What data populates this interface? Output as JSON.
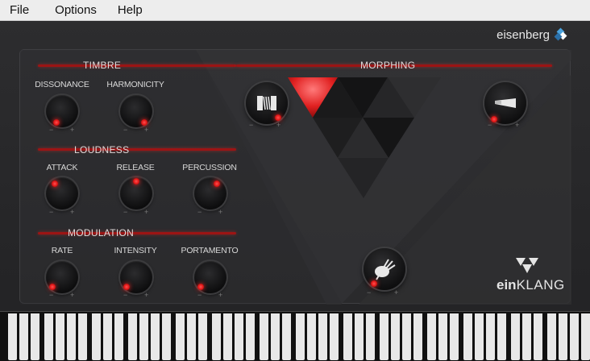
{
  "menu": {
    "file": "File",
    "options": "Options",
    "help": "Help"
  },
  "brand": {
    "name": "eisenberg",
    "colors": [
      "#4aa3df",
      "#ffffff",
      "#2a6fa8"
    ]
  },
  "sections": {
    "timbre": "TIMBRE",
    "loudness": "LOUDNESS",
    "modulation": "MODULATION",
    "morphing": "MORPHING"
  },
  "knobs": {
    "dissonance": {
      "label": "DISSONANCE",
      "minus": "−",
      "plus": "+"
    },
    "harmonicity": {
      "label": "HARMONICITY",
      "minus": "−",
      "plus": "+"
    },
    "attack": {
      "label": "ATTACK",
      "minus": "−",
      "plus": "+"
    },
    "release": {
      "label": "RELEASE",
      "minus": "−",
      "plus": "+"
    },
    "percussion": {
      "label": "PERCUSSION",
      "minus": "−",
      "plus": "+"
    },
    "rate": {
      "label": "RATE",
      "minus": "−",
      "plus": "+"
    },
    "intensity": {
      "label": "INTENSITY",
      "minus": "−",
      "plus": "+"
    },
    "portamento": {
      "label": "PORTAMENTO",
      "minus": "−",
      "plus": "+"
    }
  },
  "morph": {
    "accordion_icon": "accordion-icon",
    "flute_icon": "flute-icon",
    "bagpipe_icon": "bagpipe-icon",
    "minus": "−",
    "plus": "+"
  },
  "logo": {
    "bold": "ein",
    "rest": "KLANG"
  },
  "colors": {
    "accent": "#e01616",
    "glow": "#ff2b2b",
    "background": "#2a2a2c"
  }
}
